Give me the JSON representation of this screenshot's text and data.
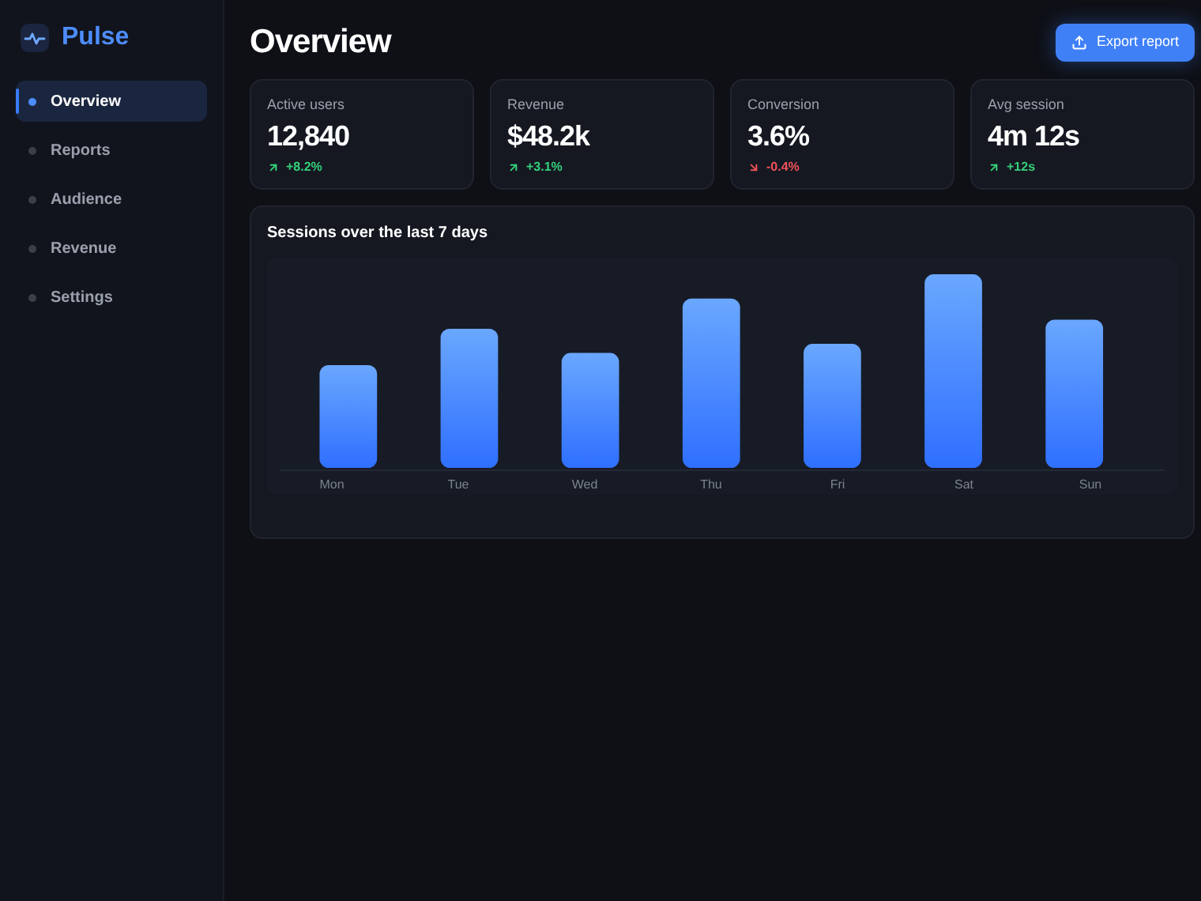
{
  "brand": {
    "name": "Pulse"
  },
  "sidebar": {
    "items": [
      {
        "label": "Overview",
        "selected": true
      },
      {
        "label": "Reports",
        "selected": false
      },
      {
        "label": "Audience",
        "selected": false
      },
      {
        "label": "Revenue",
        "selected": false
      },
      {
        "label": "Settings",
        "selected": false
      }
    ]
  },
  "header": {
    "title": "Overview",
    "button": "Export report"
  },
  "stats": [
    {
      "label": "Active users",
      "value": "12,840",
      "change": "+8.2%",
      "rising": true
    },
    {
      "label": "Revenue",
      "value": "$48.2k",
      "change": "+3.1%",
      "rising": true
    },
    {
      "label": "Conversion",
      "value": "3.6%",
      "change": "-0.4%",
      "rising": false
    },
    {
      "label": "Avg session",
      "value": "4m 12s",
      "change": "+12s",
      "rising": true
    }
  ],
  "chart": {
    "title": "Sessions over the last 7 days",
    "day_labels": [
      "Mon",
      "Tue",
      "Wed",
      "Thu",
      "Fri",
      "Sat",
      "Sun"
    ]
  }
}
